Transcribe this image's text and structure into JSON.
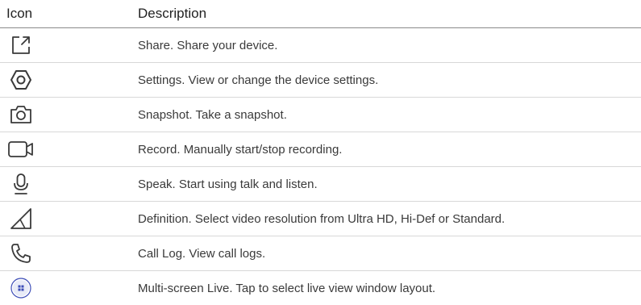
{
  "table": {
    "headers": {
      "icon": "Icon",
      "description": "Description"
    },
    "rows": [
      {
        "icon": "share-icon",
        "description": "Share. Share your device."
      },
      {
        "icon": "settings-icon",
        "description": "Settings. View or change the device settings."
      },
      {
        "icon": "camera-icon",
        "description": "Snapshot. Take a snapshot."
      },
      {
        "icon": "video-camera-icon",
        "description": "Record. Manually start/stop recording."
      },
      {
        "icon": "microphone-icon",
        "description": "Speak. Start using talk and listen."
      },
      {
        "icon": "signal-icon",
        "description": "Definition. Select video resolution from Ultra HD, Hi-Def or Standard."
      },
      {
        "icon": "phone-icon",
        "description": "Call Log. View call logs."
      },
      {
        "icon": "grid-icon",
        "description": "Multi-screen Live. Tap to select live view window layout."
      }
    ]
  },
  "colors": {
    "icon_stroke": "#3a3a3a",
    "accent_blue": "#3d4db7",
    "text": "#3a3a3a"
  }
}
